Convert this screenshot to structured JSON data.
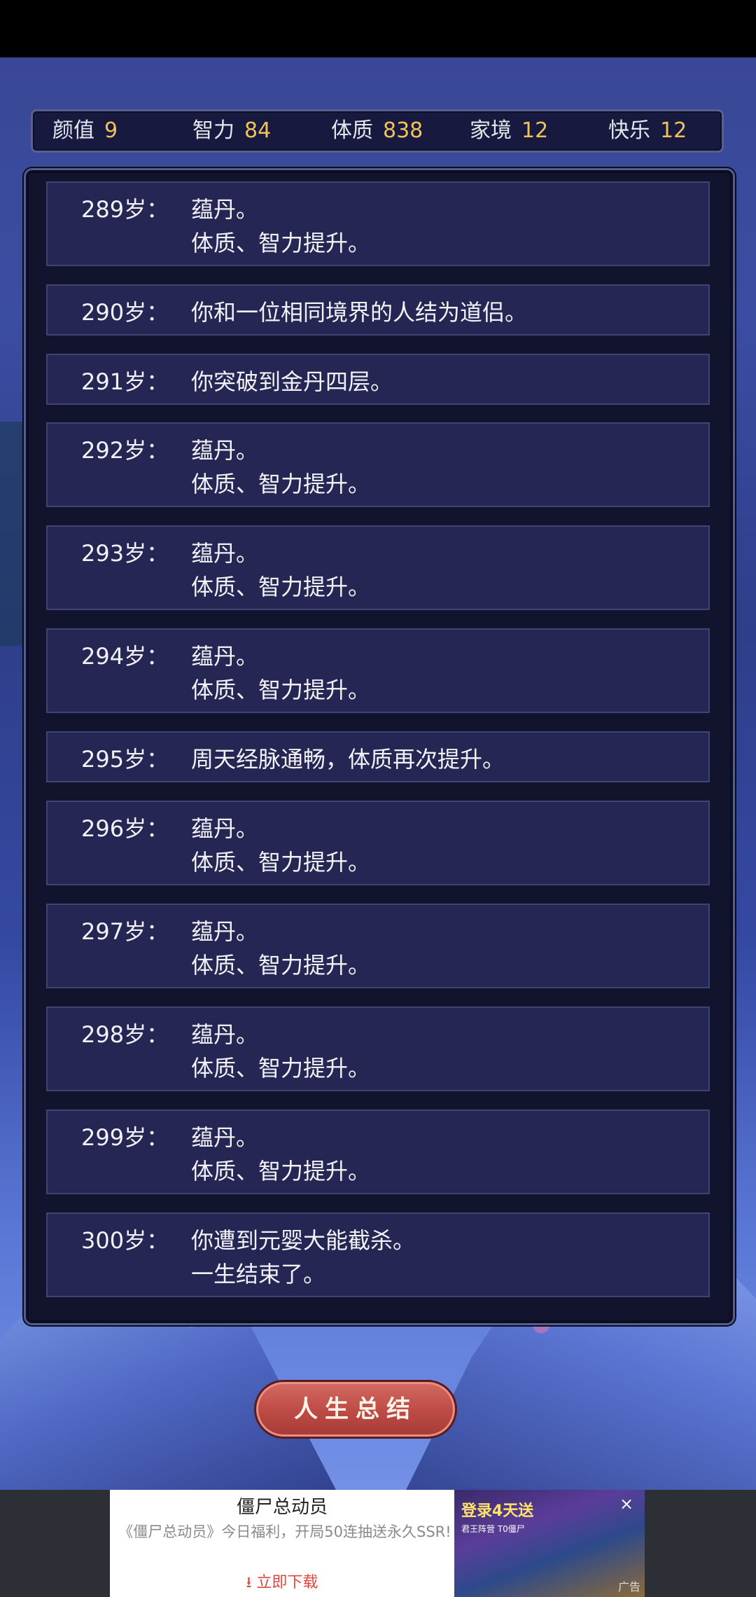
{
  "stats": [
    {
      "label": "颜值",
      "value": "9"
    },
    {
      "label": "智力",
      "value": "84"
    },
    {
      "label": "体质",
      "value": "838"
    },
    {
      "label": "家境",
      "value": "12"
    },
    {
      "label": "快乐",
      "value": "12"
    }
  ],
  "events": [
    {
      "age": "289岁：",
      "lines": [
        "蕴丹。",
        "体质、智力提升。"
      ]
    },
    {
      "age": "290岁：",
      "lines": [
        "你和一位相同境界的人结为道侣。"
      ]
    },
    {
      "age": "291岁：",
      "lines": [
        "你突破到金丹四层。"
      ]
    },
    {
      "age": "292岁：",
      "lines": [
        "蕴丹。",
        "体质、智力提升。"
      ]
    },
    {
      "age": "293岁：",
      "lines": [
        "蕴丹。",
        "体质、智力提升。"
      ]
    },
    {
      "age": "294岁：",
      "lines": [
        "蕴丹。",
        "体质、智力提升。"
      ]
    },
    {
      "age": "295岁：",
      "lines": [
        "周天经脉通畅，体质再次提升。"
      ]
    },
    {
      "age": "296岁：",
      "lines": [
        "蕴丹。",
        "体质、智力提升。"
      ]
    },
    {
      "age": "297岁：",
      "lines": [
        "蕴丹。",
        "体质、智力提升。"
      ]
    },
    {
      "age": "298岁：",
      "lines": [
        "蕴丹。",
        "体质、智力提升。"
      ]
    },
    {
      "age": "299岁：",
      "lines": [
        "蕴丹。",
        "体质、智力提升。"
      ]
    },
    {
      "age": "300岁：",
      "lines": [
        "你遭到元婴大能截杀。",
        "一生结束了。"
      ]
    }
  ],
  "summary_button": {
    "label": "人生总结"
  },
  "ad": {
    "title": "僵尸总动员",
    "description": "《僵尸总动员》今日福利，开局50连抽送永久SSR!",
    "download_label": "立即下载",
    "image_text": "登录4天送",
    "image_sub": "君王阵营 T0僵尸",
    "close_icon": "×",
    "ad_tag": "广告"
  },
  "colors": {
    "stat_value": "#f0c25a",
    "button": "#bd4a44",
    "row_bg": "#252654"
  }
}
